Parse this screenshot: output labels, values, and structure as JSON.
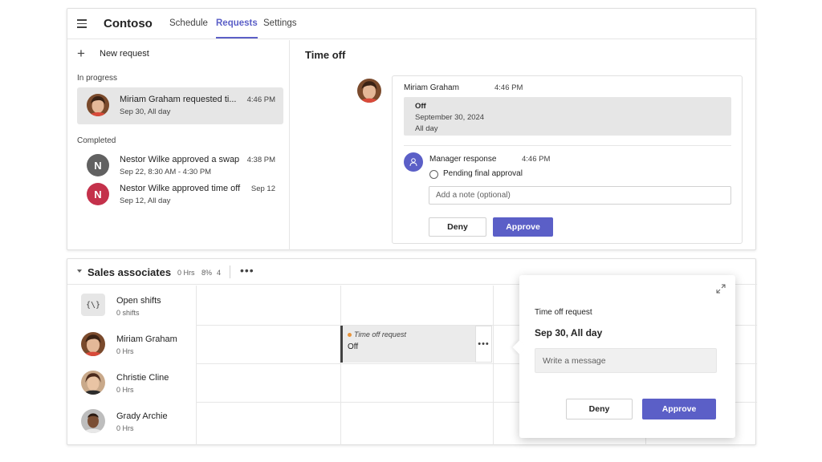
{
  "header": {
    "brand": "Contoso",
    "tabs": [
      {
        "label": "Schedule",
        "active": false
      },
      {
        "label": "Requests",
        "active": true
      },
      {
        "label": "Settings",
        "active": false
      }
    ]
  },
  "requests": {
    "new_request_label": "New request",
    "in_progress_label": "In progress",
    "completed_label": "Completed",
    "in_progress": [
      {
        "title": "Miriam Graham requested ti...",
        "subtitle": "Sep 30, All day",
        "time": "4:46 PM"
      }
    ],
    "completed": [
      {
        "initial": "N",
        "color": "#616161",
        "title": "Nestor Wilke approved a swap",
        "subtitle": "Sep 22, 8:30 AM - 4:30 PM",
        "time": "4:38 PM"
      },
      {
        "initial": "N",
        "color": "#c4314b",
        "title": "Nestor Wilke approved time off",
        "subtitle": "Sep 12, All day",
        "time": "Sep 12"
      }
    ]
  },
  "detail": {
    "title": "Time off",
    "requester": "Miriam Graham",
    "time": "4:46 PM",
    "off_label": "Off",
    "off_date": "September 30, 2024",
    "off_duration": "All day",
    "manager_label": "Manager response",
    "manager_time": "4:46 PM",
    "status": "Pending final approval",
    "note_placeholder": "Add a note (optional)",
    "deny_label": "Deny",
    "approve_label": "Approve"
  },
  "schedule": {
    "group_name": "Sales associates",
    "stats": [
      "0 Hrs",
      "8%",
      "4"
    ],
    "rows": [
      {
        "name": "Open shifts",
        "sub": "0 shifts"
      },
      {
        "name": "Miriam Graham",
        "sub": "0 Hrs"
      },
      {
        "name": "Christie Cline",
        "sub": "0 Hrs"
      },
      {
        "name": "Grady Archie",
        "sub": "0 Hrs"
      }
    ],
    "shift": {
      "label": "Time off request",
      "sub": "Off"
    }
  },
  "popover": {
    "title": "Time off request",
    "date": "Sep 30, All day",
    "message_placeholder": "Write a message",
    "deny_label": "Deny",
    "approve_label": "Approve"
  },
  "colors": {
    "accent": "#5b5fc7"
  }
}
